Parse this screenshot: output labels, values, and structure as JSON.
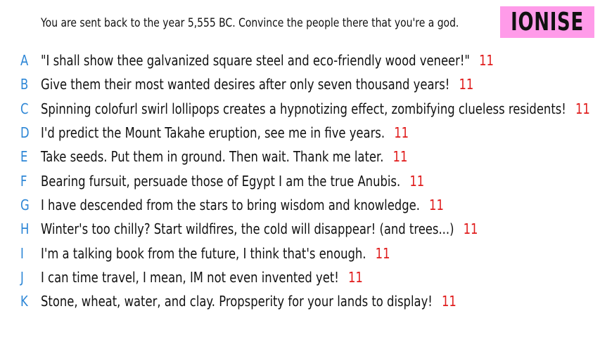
{
  "prompt": "You are sent back to the year 5,555 BC. Convince the people there that you're a god.",
  "logo": "IONISE",
  "colors": {
    "letter": "#2c86d6",
    "score": "#e01b1b",
    "logo_bg": "#ff9be9",
    "text": "#111111"
  },
  "answers": [
    {
      "letter": "A",
      "text": "\"I shall show thee galvanized square steel and eco-friendly wood veneer!\"",
      "score": "11"
    },
    {
      "letter": "B",
      "text": "Give them their most wanted desires after only seven thousand years!",
      "score": "11"
    },
    {
      "letter": "C",
      "text": "Spinning colofurl swirl lollipops creates a hypnotizing effect, zombifying clueless residents!",
      "score": "11"
    },
    {
      "letter": "D",
      "text": "I'd predict the Mount Takahe eruption, see me in five years.",
      "score": "11"
    },
    {
      "letter": "E",
      "text": "Take seeds. Put them in ground. Then wait. Thank me later.",
      "score": "11"
    },
    {
      "letter": "F",
      "text": "Bearing fursuit, persuade those of Egypt I am the true Anubis.",
      "score": "11"
    },
    {
      "letter": "G",
      "text": "I have descended from the stars to bring wisdom and knowledge.",
      "score": "11"
    },
    {
      "letter": "H",
      "text": "Winter's too chilly? Start wildfires, the cold will disappear! (and trees...)",
      "score": "11"
    },
    {
      "letter": "I",
      "text": "I'm a talking book from the future, I think that's enough.",
      "score": "11"
    },
    {
      "letter": "J",
      "text": "I can time travel, I mean, IM not even invented yet!",
      "score": "11"
    },
    {
      "letter": "K",
      "text": "Stone, wheat, water, and clay. Propsperity for your lands to display!",
      "score": "11"
    }
  ]
}
